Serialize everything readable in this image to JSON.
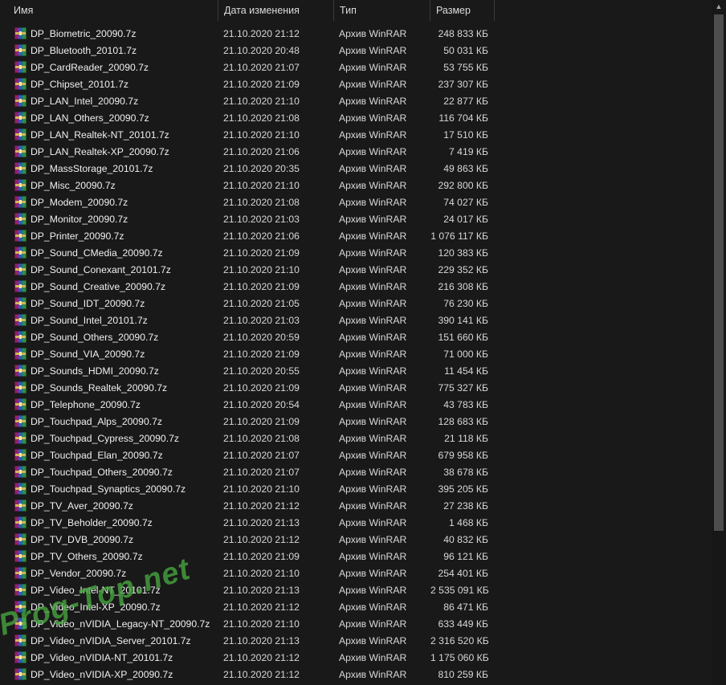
{
  "columns": {
    "name": "Имя",
    "date": "Дата изменения",
    "type": "Тип",
    "size": "Размер"
  },
  "sort_indicator": "^",
  "icon": "winrar-archive-icon",
  "files": [
    {
      "name": "DP_Biometric_20090.7z",
      "date": "21.10.2020 21:12",
      "type": "Архив WinRAR",
      "size": "248 833 КБ"
    },
    {
      "name": "DP_Bluetooth_20101.7z",
      "date": "21.10.2020 20:48",
      "type": "Архив WinRAR",
      "size": "50 031 КБ"
    },
    {
      "name": "DP_CardReader_20090.7z",
      "date": "21.10.2020 21:07",
      "type": "Архив WinRAR",
      "size": "53 755 КБ"
    },
    {
      "name": "DP_Chipset_20101.7z",
      "date": "21.10.2020 21:09",
      "type": "Архив WinRAR",
      "size": "237 307 КБ"
    },
    {
      "name": "DP_LAN_Intel_20090.7z",
      "date": "21.10.2020 21:10",
      "type": "Архив WinRAR",
      "size": "22 877 КБ"
    },
    {
      "name": "DP_LAN_Others_20090.7z",
      "date": "21.10.2020 21:08",
      "type": "Архив WinRAR",
      "size": "116 704 КБ"
    },
    {
      "name": "DP_LAN_Realtek-NT_20101.7z",
      "date": "21.10.2020 21:10",
      "type": "Архив WinRAR",
      "size": "17 510 КБ"
    },
    {
      "name": "DP_LAN_Realtek-XP_20090.7z",
      "date": "21.10.2020 21:06",
      "type": "Архив WinRAR",
      "size": "7 419 КБ"
    },
    {
      "name": "DP_MassStorage_20101.7z",
      "date": "21.10.2020 20:35",
      "type": "Архив WinRAR",
      "size": "49 863 КБ"
    },
    {
      "name": "DP_Misc_20090.7z",
      "date": "21.10.2020 21:10",
      "type": "Архив WinRAR",
      "size": "292 800 КБ"
    },
    {
      "name": "DP_Modem_20090.7z",
      "date": "21.10.2020 21:08",
      "type": "Архив WinRAR",
      "size": "74 027 КБ"
    },
    {
      "name": "DP_Monitor_20090.7z",
      "date": "21.10.2020 21:03",
      "type": "Архив WinRAR",
      "size": "24 017 КБ"
    },
    {
      "name": "DP_Printer_20090.7z",
      "date": "21.10.2020 21:06",
      "type": "Архив WinRAR",
      "size": "1 076 117 КБ"
    },
    {
      "name": "DP_Sound_CMedia_20090.7z",
      "date": "21.10.2020 21:09",
      "type": "Архив WinRAR",
      "size": "120 383 КБ"
    },
    {
      "name": "DP_Sound_Conexant_20101.7z",
      "date": "21.10.2020 21:10",
      "type": "Архив WinRAR",
      "size": "229 352 КБ"
    },
    {
      "name": "DP_Sound_Creative_20090.7z",
      "date": "21.10.2020 21:09",
      "type": "Архив WinRAR",
      "size": "216 308 КБ"
    },
    {
      "name": "DP_Sound_IDT_20090.7z",
      "date": "21.10.2020 21:05",
      "type": "Архив WinRAR",
      "size": "76 230 КБ"
    },
    {
      "name": "DP_Sound_Intel_20101.7z",
      "date": "21.10.2020 21:03",
      "type": "Архив WinRAR",
      "size": "390 141 КБ"
    },
    {
      "name": "DP_Sound_Others_20090.7z",
      "date": "21.10.2020 20:59",
      "type": "Архив WinRAR",
      "size": "151 660 КБ"
    },
    {
      "name": "DP_Sound_VIA_20090.7z",
      "date": "21.10.2020 21:09",
      "type": "Архив WinRAR",
      "size": "71 000 КБ"
    },
    {
      "name": "DP_Sounds_HDMI_20090.7z",
      "date": "21.10.2020 20:55",
      "type": "Архив WinRAR",
      "size": "11 454 КБ"
    },
    {
      "name": "DP_Sounds_Realtek_20090.7z",
      "date": "21.10.2020 21:09",
      "type": "Архив WinRAR",
      "size": "775 327 КБ"
    },
    {
      "name": "DP_Telephone_20090.7z",
      "date": "21.10.2020 20:54",
      "type": "Архив WinRAR",
      "size": "43 783 КБ"
    },
    {
      "name": "DP_Touchpad_Alps_20090.7z",
      "date": "21.10.2020 21:09",
      "type": "Архив WinRAR",
      "size": "128 683 КБ"
    },
    {
      "name": "DP_Touchpad_Cypress_20090.7z",
      "date": "21.10.2020 21:08",
      "type": "Архив WinRAR",
      "size": "21 118 КБ"
    },
    {
      "name": "DP_Touchpad_Elan_20090.7z",
      "date": "21.10.2020 21:07",
      "type": "Архив WinRAR",
      "size": "679 958 КБ"
    },
    {
      "name": "DP_Touchpad_Others_20090.7z",
      "date": "21.10.2020 21:07",
      "type": "Архив WinRAR",
      "size": "38 678 КБ"
    },
    {
      "name": "DP_Touchpad_Synaptics_20090.7z",
      "date": "21.10.2020 21:10",
      "type": "Архив WinRAR",
      "size": "395 205 КБ"
    },
    {
      "name": "DP_TV_Aver_20090.7z",
      "date": "21.10.2020 21:12",
      "type": "Архив WinRAR",
      "size": "27 238 КБ"
    },
    {
      "name": "DP_TV_Beholder_20090.7z",
      "date": "21.10.2020 21:13",
      "type": "Архив WinRAR",
      "size": "1 468 КБ"
    },
    {
      "name": "DP_TV_DVB_20090.7z",
      "date": "21.10.2020 21:12",
      "type": "Архив WinRAR",
      "size": "40 832 КБ"
    },
    {
      "name": "DP_TV_Others_20090.7z",
      "date": "21.10.2020 21:09",
      "type": "Архив WinRAR",
      "size": "96 121 КБ"
    },
    {
      "name": "DP_Vendor_20090.7z",
      "date": "21.10.2020 21:10",
      "type": "Архив WinRAR",
      "size": "254 401 КБ"
    },
    {
      "name": "DP_Video_Intel-NT_20101.7z",
      "date": "21.10.2020 21:13",
      "type": "Архив WinRAR",
      "size": "2 535 091 КБ"
    },
    {
      "name": "DP_Video_Intel-XP_20090.7z",
      "date": "21.10.2020 21:12",
      "type": "Архив WinRAR",
      "size": "86 471 КБ"
    },
    {
      "name": "DP_Video_nVIDIA_Legacy-NT_20090.7z",
      "date": "21.10.2020 21:10",
      "type": "Архив WinRAR",
      "size": "633 449 КБ"
    },
    {
      "name": "DP_Video_nVIDIA_Server_20101.7z",
      "date": "21.10.2020 21:13",
      "type": "Архив WinRAR",
      "size": "2 316 520 КБ"
    },
    {
      "name": "DP_Video_nVIDIA-NT_20101.7z",
      "date": "21.10.2020 21:12",
      "type": "Архив WinRAR",
      "size": "1 175 060 КБ"
    },
    {
      "name": "DP_Video_nVIDIA-XP_20090.7z",
      "date": "21.10.2020 21:12",
      "type": "Архив WinRAR",
      "size": "810 259 КБ"
    }
  ],
  "watermark": "Prog-Top.net",
  "colors": {
    "background": "#191919",
    "text": "#e6e6e6",
    "scroll_thumb": "#4d4d4d",
    "watermark": "#48a840"
  }
}
